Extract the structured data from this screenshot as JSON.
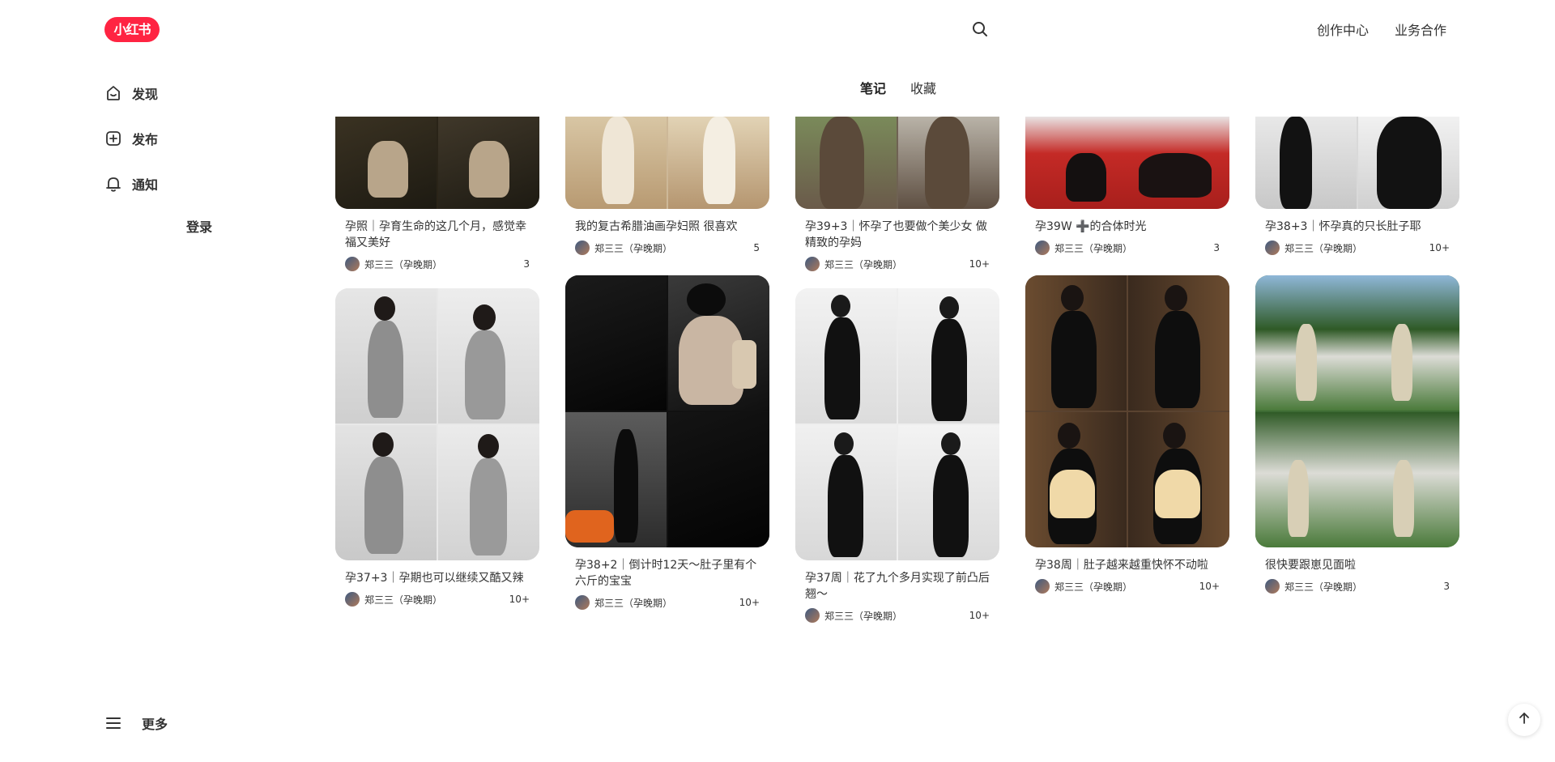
{
  "header": {
    "logo_text": "小红书",
    "nav": [
      "创作中心",
      "业务合作"
    ]
  },
  "sidebar": {
    "items": [
      {
        "label": "发现",
        "icon": "home-icon"
      },
      {
        "label": "发布",
        "icon": "plus-square-icon"
      },
      {
        "label": "通知",
        "icon": "bell-icon"
      }
    ],
    "login_label": "登录",
    "more_label": "更多"
  },
  "tabs": [
    {
      "label": "笔记",
      "active": true
    },
    {
      "label": "收藏",
      "active": false
    }
  ],
  "author_name": "郑三三（孕晚期）",
  "notes": [
    {
      "title": "孕照｜孕育生命的这几个月，感觉幸福又美好",
      "likes": "3"
    },
    {
      "title": "孕37+3｜孕期也可以继续又酷又辣",
      "likes": "10+"
    },
    {
      "title": "我的复古希腊油画孕妇照 很喜欢",
      "likes": "5"
    },
    {
      "title": "孕38+2｜倒计时12天～肚子里有个六斤的宝宝",
      "likes": "10+"
    },
    {
      "title": "孕39+3｜怀孕了也要做个美少女 做精致的孕妈",
      "likes": "10+"
    },
    {
      "title": "孕37周｜花了九个多月实现了前凸后翘～",
      "likes": "10+"
    },
    {
      "title": "孕39W ➕的合体时光",
      "likes": "3"
    },
    {
      "title": "孕38周｜肚子越来越重快怀不动啦",
      "likes": "10+"
    },
    {
      "title": "孕38+3｜怀孕真的只长肚子耶",
      "likes": "10+"
    },
    {
      "title": "很快要跟崽见面啦",
      "likes": "3"
    }
  ],
  "colors": {
    "brand": "#ff2442",
    "text": "#333333"
  }
}
